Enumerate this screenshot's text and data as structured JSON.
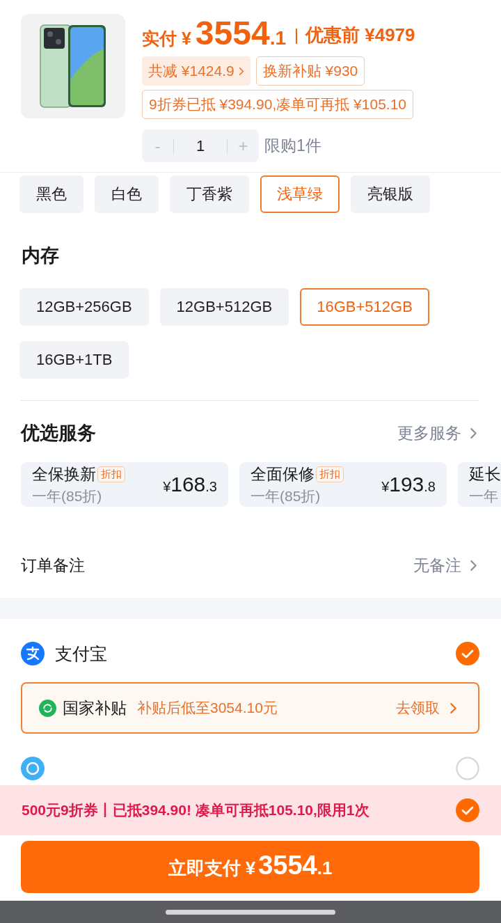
{
  "price": {
    "label": "实付",
    "currency": "¥",
    "integer": "3554",
    "decimal": ".1",
    "original": "优惠前 ¥4979"
  },
  "tags": [
    {
      "kind": "discount",
      "text": "共减 ¥1424.9"
    },
    {
      "kind": "subsidy",
      "text": "换新补贴 ¥930"
    }
  ],
  "coupon_note": "9折券已抵 ¥394.90,凑单可再抵 ¥105.10",
  "quantity": {
    "minus": "-",
    "value": "1",
    "plus": "+",
    "limit": "限购1件"
  },
  "colors": [
    {
      "label": "黑色",
      "selected": false
    },
    {
      "label": "白色",
      "selected": false
    },
    {
      "label": "丁香紫",
      "selected": false
    },
    {
      "label": "浅草绿",
      "selected": true
    },
    {
      "label": "亮银版",
      "selected": false
    }
  ],
  "memory": {
    "title": "内存",
    "options": [
      {
        "label": "12GB+256GB",
        "selected": false
      },
      {
        "label": "12GB+512GB",
        "selected": false
      },
      {
        "label": "16GB+512GB",
        "selected": true
      },
      {
        "label": "16GB+1TB",
        "selected": false
      }
    ]
  },
  "services": {
    "title": "优选服务",
    "more": "更多服务",
    "cards": [
      {
        "title": "全保换新",
        "tag": "折扣",
        "subtitle": "一年(85折)",
        "currency": "¥",
        "integer": "168",
        "decimal": ".3"
      },
      {
        "title": "全面保修",
        "tag": "折扣",
        "subtitle": "一年(85折)",
        "currency": "¥",
        "integer": "193",
        "decimal": ".8"
      },
      {
        "title": "延长",
        "subtitle": "一年"
      }
    ]
  },
  "order_note": {
    "label": "订单备注",
    "value": "无备注"
  },
  "payment_methods": [
    {
      "kind": "alipay",
      "label": "支付宝",
      "selected": true
    },
    {
      "kind": "installment",
      "selected": false
    }
  ],
  "subsidy": {
    "label": "国家补贴",
    "text": "补贴后低至3054.10元",
    "action": "去领取"
  },
  "coupon_bar": {
    "text": "500元9折券丨已抵394.90! 凑单可再抵105.10,限用1次",
    "checked": true
  },
  "pay_button": {
    "label": "立即支付",
    "currency": "¥",
    "integer": "3554",
    "decimal": ".1"
  }
}
